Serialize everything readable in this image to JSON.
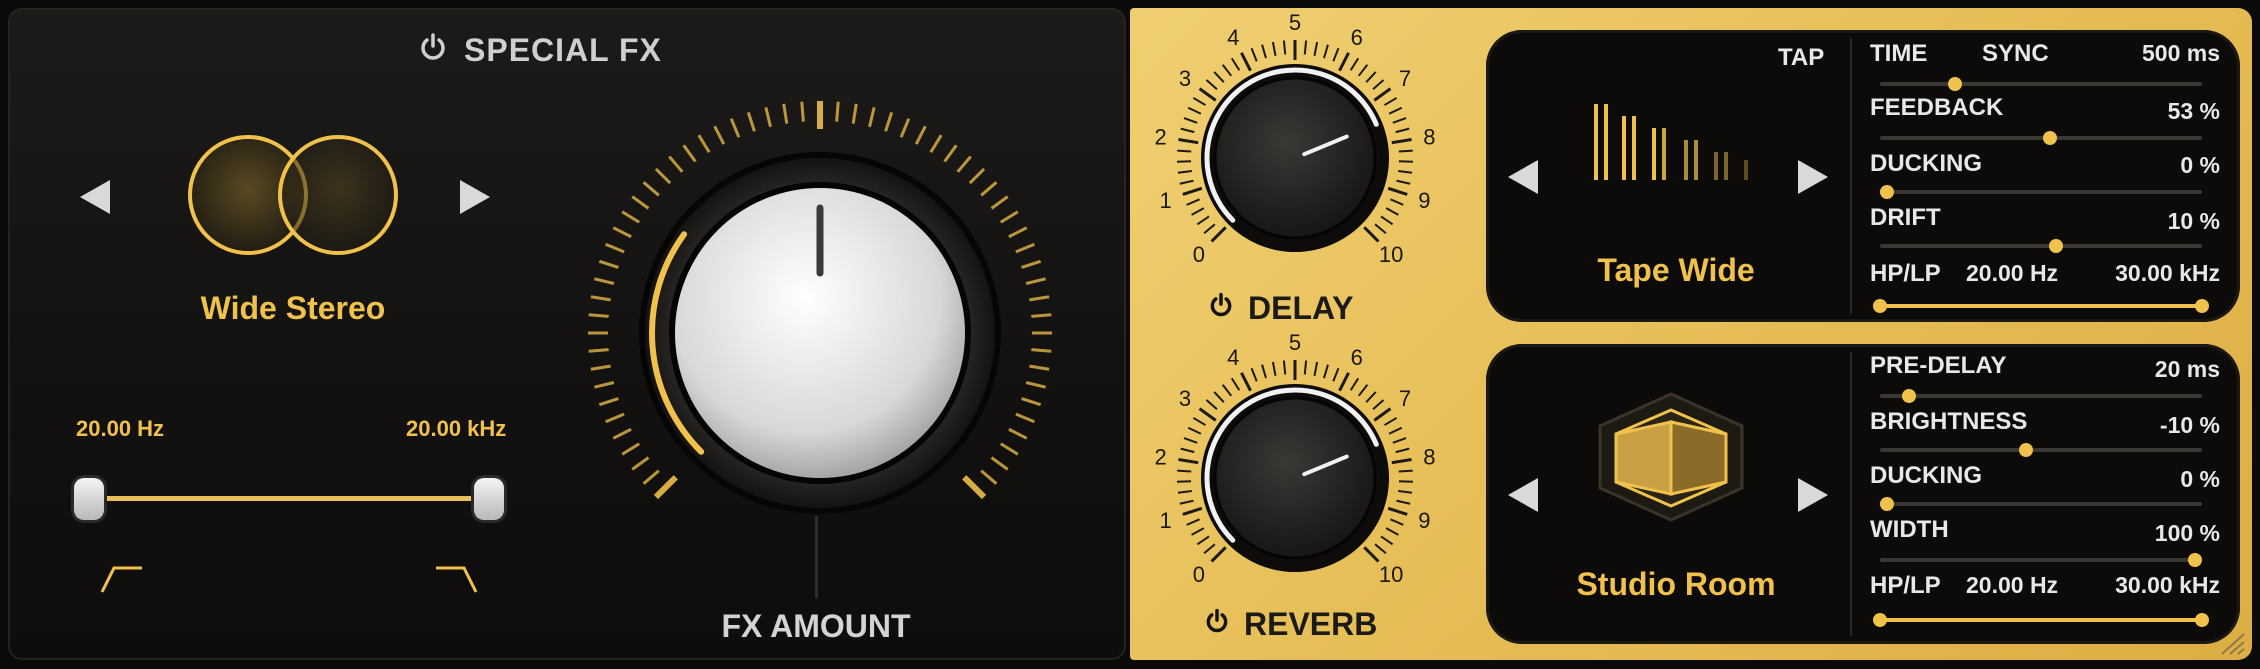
{
  "special_fx": {
    "title": "SPECIAL FX",
    "mode_name": "Wide Stereo",
    "low_freq": "20.00 Hz",
    "high_freq": "20.00 kHz",
    "fx_amount_label": "FX AMOUNT",
    "fx_amount_level": 0.3
  },
  "delay": {
    "title": "DELAY",
    "knob_ticks": [
      "0",
      "1",
      "2",
      "3",
      "4",
      "5",
      "6",
      "7",
      "8",
      "9",
      "10"
    ],
    "knob_value": 7.5,
    "preset_name": "Tape Wide",
    "tap_label": "TAP",
    "params": {
      "time_label": "TIME",
      "sync_label": "SYNC",
      "time_value": "500 ms",
      "time_level": 0.22,
      "feedback_label": "FEEDBACK",
      "feedback_value": "53 %",
      "feedback_level": 0.53,
      "ducking_label": "DUCKING",
      "ducking_value": "0 %",
      "ducking_level": 0.0,
      "drift_label": "DRIFT",
      "drift_value": "10 %",
      "drift_level": 0.55,
      "hplp_label": "HP/LP",
      "hp_value": "20.00 Hz",
      "lp_value": "30.00 kHz"
    }
  },
  "reverb": {
    "title": "REVERB",
    "knob_ticks": [
      "0",
      "1",
      "2",
      "3",
      "4",
      "5",
      "6",
      "7",
      "8",
      "9",
      "10"
    ],
    "knob_value": 7.5,
    "preset_name": "Studio Room",
    "params": {
      "predelay_label": "PRE-DELAY",
      "predelay_value": "20 ms",
      "predelay_level": 0.07,
      "brightness_label": "BRIGHTNESS",
      "brightness_value": "-10 %",
      "brightness_level": 0.45,
      "ducking_label": "DUCKING",
      "ducking_value": "0 %",
      "ducking_level": 0.0,
      "width_label": "WIDTH",
      "width_value": "100 %",
      "width_level": 1.0,
      "hplp_label": "HP/LP",
      "hp_value": "20.00 Hz",
      "lp_value": "30.00 kHz"
    }
  },
  "colors": {
    "accent": "#f0c24c",
    "panel_gold": "#e7bf58",
    "dark": "#0c0b0a"
  }
}
